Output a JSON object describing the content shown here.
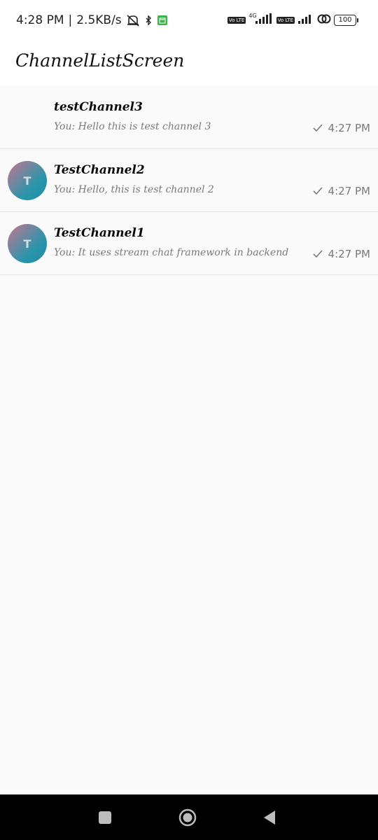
{
  "status_bar": {
    "time": "4:28 PM",
    "separator": "|",
    "network_speed": "2.5KB/s",
    "volte1": "Vo LTE",
    "net_type": "4G",
    "volte2": "Vo LTE",
    "battery": "100"
  },
  "app_bar": {
    "title": "ChannelListScreen"
  },
  "channels": [
    {
      "avatar_initial": "",
      "name": "testChannel3",
      "last_message": "You: Hello this is test channel 3",
      "time": "4:27 PM"
    },
    {
      "avatar_initial": "T",
      "name": "TestChannel2",
      "last_message": "You: Hello, this is test channel 2",
      "time": "4:27 PM"
    },
    {
      "avatar_initial": "T",
      "name": "TestChannel1",
      "last_message": "You: It uses stream chat framework in backend",
      "time": "4:27 PM"
    }
  ],
  "colors": {
    "avatar_gradient_start": "#c9748f",
    "avatar_gradient_end": "#1f8fa8",
    "secondary_text": "#7a7a7a"
  },
  "icons": {
    "status_icons": [
      "mute-alarm-icon",
      "bluetooth-icon",
      "calendar-icon",
      "signal-icon",
      "wifi-link-icon",
      "battery-icon"
    ],
    "list_icons": [
      "check-icon"
    ],
    "nav_icons": [
      "recents-icon",
      "home-icon",
      "back-icon"
    ]
  }
}
